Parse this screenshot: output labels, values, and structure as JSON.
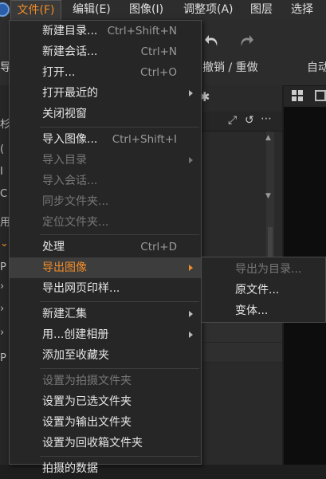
{
  "menubar": {
    "items": [
      "文件(F)",
      "编辑(E)",
      "图像(I)",
      "调整项(A)",
      "图层",
      "选择"
    ]
  },
  "toolbar": {
    "left_partial": "导",
    "undo_redo_label": "撤销 / 重做",
    "right_partial": "自动"
  },
  "file_menu": {
    "items": [
      {
        "label": "新建目录...",
        "shortcut": "Ctrl+Shift+N"
      },
      {
        "label": "新建会话...",
        "shortcut": "Ctrl+N"
      },
      {
        "label": "打开...",
        "shortcut": "Ctrl+O"
      },
      {
        "label": "打开最近的"
      },
      {
        "label": "关闭视窗"
      },
      {
        "label": "导入图像...",
        "shortcut": "Ctrl+Shift+I"
      },
      {
        "label": "导入目录"
      },
      {
        "label": "导入会话..."
      },
      {
        "label": "同步文件夹..."
      },
      {
        "label": "定位文件夹..."
      },
      {
        "label": "处理",
        "shortcut": "Ctrl+D"
      },
      {
        "label": "导出图像"
      },
      {
        "label": "导出网页印样..."
      },
      {
        "label": "新建汇集"
      },
      {
        "label": "用...创建相册"
      },
      {
        "label": "添加至收藏夹"
      },
      {
        "label": "设置为拍摄文件夹"
      },
      {
        "label": "设置为已选文件夹"
      },
      {
        "label": "设置为输出文件夹"
      },
      {
        "label": "设置为回收箱文件夹"
      },
      {
        "label": "拍摄的数据"
      }
    ]
  },
  "export_submenu": {
    "items": [
      "导出为目录...",
      "原文件...",
      "变体..."
    ]
  },
  "left_strip": {
    "glyphs": [
      "导",
      "杉",
      "(",
      "I",
      "C",
      "I",
      "用",
      "P",
      "P"
    ]
  },
  "colors": {
    "accent": "#f28c28",
    "menu_bg": "#262626",
    "highlight_bg": "#3d3d3d"
  }
}
